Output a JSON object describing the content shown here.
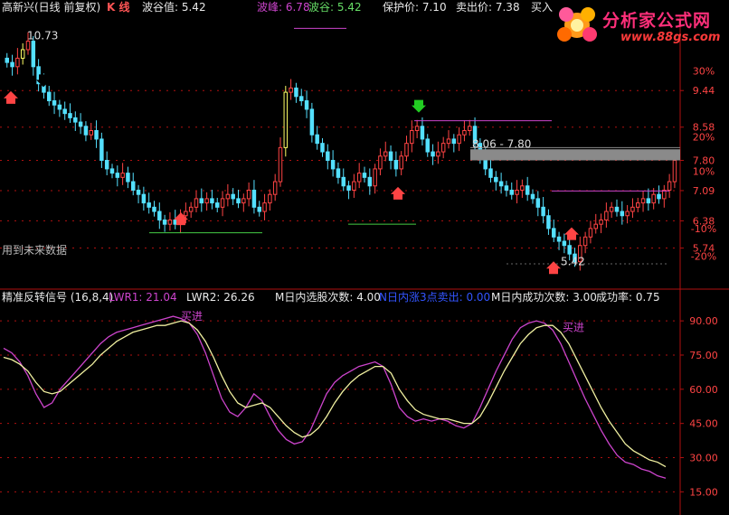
{
  "header": {
    "title": "高新兴(日线 前复权)",
    "k_label": "K 线",
    "trough_label": "波谷值: 5.42",
    "peak_label": "波峰: 6.78",
    "trough2_label": "波谷: 5.42",
    "protect_label": "保护价: 7.10",
    "sell_label": "卖出价: 7.38",
    "buy_label": "买入"
  },
  "logo": {
    "text": "分析家公式网",
    "url": "www.88gs.com"
  },
  "future_note": "用到未来数据",
  "indicator": {
    "name": "精准反转信号 (16,8,4)",
    "lwr1": "LWR1: 21.04",
    "lwr2": "LWR2: 26.26",
    "m_count": "M日内选股次数: 4.00",
    "n_sell": "N日内涨3点卖出: 0.00",
    "m_success": "M日内成功次数: 3.00",
    "rate": "成功率: 0.75",
    "buy_marker": "买进"
  },
  "colors": {
    "up": "#ff4444",
    "down": "#54e0ff",
    "yellow": "#ffff66",
    "magenta": "#cc44cc",
    "axis": "#b01010"
  },
  "chart_data": [
    {
      "type": "candlestick",
      "title": "高新兴(日线 前复权)",
      "price_ticks": [
        9.44,
        8.58,
        7.8,
        7.09,
        6.38,
        5.74
      ],
      "percent_ticks": [
        "30%",
        "20%",
        "10%",
        "-10%",
        "-20%"
      ],
      "price_labels": [
        "10.73",
        "8.06 - 7.80",
        "5.42"
      ],
      "ylim": [
        5.2,
        11.1
      ],
      "closes": [
        10.1,
        10.0,
        10.2,
        10.4,
        10.6,
        10.0,
        9.6,
        9.4,
        9.2,
        9.1,
        9.0,
        8.9,
        8.8,
        8.7,
        8.6,
        8.4,
        8.5,
        8.3,
        7.8,
        7.6,
        7.5,
        7.4,
        7.5,
        7.3,
        7.1,
        7.0,
        6.8,
        6.7,
        6.6,
        6.4,
        6.3,
        6.4,
        6.3,
        6.5,
        6.6,
        6.7,
        6.9,
        6.8,
        6.9,
        6.8,
        6.7,
        6.9,
        7.0,
        6.9,
        6.8,
        6.9,
        7.1,
        6.7,
        6.6,
        6.8,
        7.0,
        7.3,
        8.1,
        9.4,
        9.5,
        9.3,
        9.2,
        9.0,
        8.4,
        8.2,
        8.0,
        7.8,
        7.6,
        7.4,
        7.2,
        7.1,
        7.3,
        7.5,
        7.4,
        7.2,
        7.6,
        7.9,
        8.0,
        7.8,
        7.6,
        7.9,
        8.2,
        8.5,
        8.6,
        8.3,
        8.0,
        7.9,
        8.0,
        8.2,
        8.3,
        8.2,
        8.4,
        8.5,
        8.6,
        8.2,
        7.9,
        7.6,
        7.4,
        7.3,
        7.2,
        7.1,
        7.0,
        7.1,
        7.2,
        7.0,
        6.9,
        6.7,
        6.5,
        6.2,
        6.0,
        5.9,
        5.8,
        5.6,
        5.42,
        5.8,
        6.0,
        6.2,
        6.3,
        6.4,
        6.6,
        6.7,
        6.6,
        6.5,
        6.6,
        6.7,
        6.8,
        6.9,
        6.8,
        7.0,
        6.9,
        7.1,
        7.3,
        7.8
      ],
      "protect_price": 7.1,
      "sell_price": 7.38,
      "trough": 5.42,
      "peak": 6.78
    },
    {
      "type": "line",
      "title": "精准反转信号 (16,8,4)",
      "y_ticks": [
        90.0,
        75.0,
        60.0,
        45.0,
        30.0,
        15.0
      ],
      "ylim": [
        8,
        96
      ],
      "series": [
        {
          "name": "LWR1",
          "values": [
            78,
            76,
            72,
            66,
            58,
            52,
            54,
            60,
            64,
            68,
            72,
            76,
            80,
            83,
            85,
            86,
            87,
            88,
            89,
            90,
            91,
            92,
            91,
            89,
            84,
            76,
            66,
            56,
            50,
            48,
            52,
            58,
            55,
            48,
            42,
            38,
            36,
            37,
            42,
            50,
            58,
            63,
            66,
            68,
            70,
            71,
            72,
            70,
            62,
            52,
            48,
            46,
            47,
            46,
            47,
            46,
            44,
            43,
            45,
            52,
            60,
            68,
            75,
            82,
            87,
            89,
            90,
            89,
            86,
            80,
            72,
            64,
            56,
            49,
            42,
            36,
            31,
            28,
            27,
            25,
            24,
            22,
            21
          ]
        },
        {
          "name": "LWR2",
          "values": [
            74,
            73,
            71,
            68,
            63,
            59,
            58,
            59,
            62,
            65,
            68,
            71,
            75,
            78,
            81,
            83,
            85,
            86,
            87,
            88,
            88,
            89,
            90,
            89,
            86,
            81,
            74,
            66,
            59,
            54,
            52,
            53,
            54,
            52,
            48,
            44,
            41,
            39,
            40,
            43,
            48,
            54,
            59,
            63,
            66,
            68,
            70,
            70,
            67,
            60,
            55,
            51,
            49,
            48,
            47,
            47,
            46,
            45,
            45,
            48,
            54,
            61,
            68,
            74,
            80,
            84,
            87,
            88,
            88,
            85,
            80,
            73,
            66,
            59,
            52,
            46,
            41,
            36,
            33,
            31,
            29,
            28,
            26
          ]
        }
      ]
    }
  ]
}
